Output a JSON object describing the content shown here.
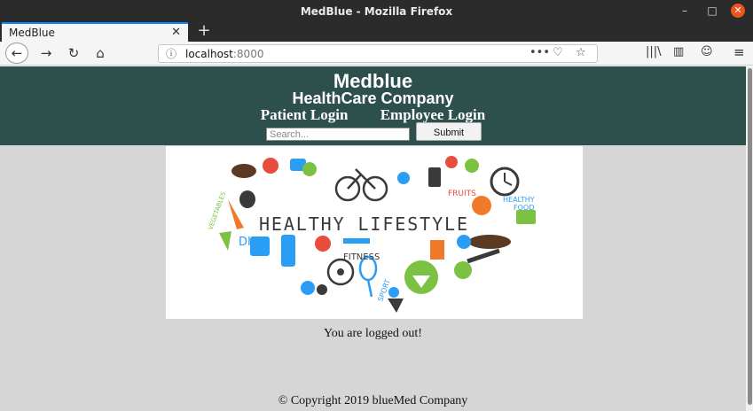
{
  "window": {
    "title": "MedBlue - Mozilla Firefox",
    "minimize_glyph": "–",
    "maximize_glyph": "□",
    "close_glyph": "✕"
  },
  "browser": {
    "tab_title": "MedBlue",
    "tab_close_glyph": "✕",
    "new_tab_glyph": "+",
    "url_host": "localhost",
    "url_port": ":8000",
    "icons": {
      "back": "←",
      "forward": "→",
      "reload": "↻",
      "home": "⌂",
      "info": "ⓘ",
      "more": "•••",
      "pocket": "♡",
      "star": "☆",
      "library": "|||\\",
      "sidebar": "▥",
      "account": "☺",
      "menu": "≡"
    }
  },
  "site": {
    "brand": "Medblue",
    "tagline": "HealthCare Company",
    "patient_login": "Patient Login",
    "employee_login": "Employee Login",
    "search_placeholder": "Search...",
    "submit_label": "Submit"
  },
  "hero": {
    "main_text": "HEALTHY LIFESTYLE",
    "diet": "DIET",
    "fitness": "FITNESS",
    "fruits": "FRUITS",
    "healthy_food_1": "HEALTHY",
    "healthy_food_2": "FOOD",
    "vegetables": "VEGETABLES",
    "sport": "SPORT"
  },
  "main": {
    "status": "You are logged out!",
    "copyright": "© Copyright 2019 blueMed Company"
  }
}
